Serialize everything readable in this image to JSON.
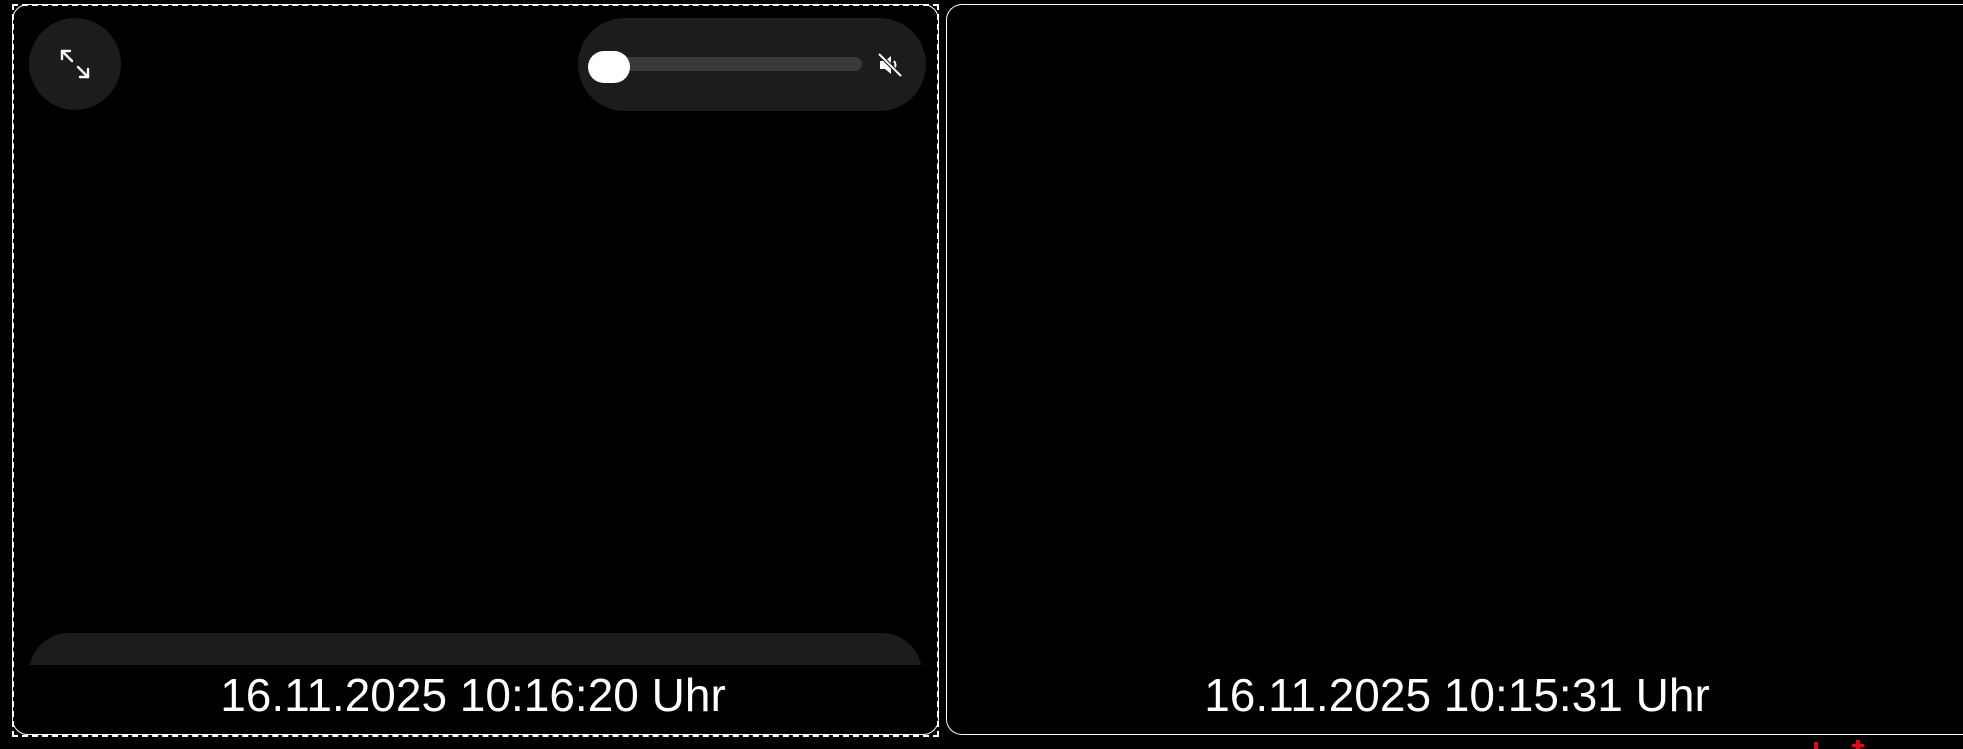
{
  "cameras": [
    {
      "timestamp": "16.11.2025 10:16:20 Uhr",
      "controls": {
        "fullscreen_icon": "expand-arrows-icon",
        "volume_level": 0,
        "mute_icon": "speaker-muted-icon"
      }
    },
    {
      "timestamp": "16.11.2025 10:15:31 Uhr"
    }
  ],
  "colors": {
    "background": "#000000",
    "panel": "#1c1c1c",
    "border": "#ffffff",
    "text": "#ffffff",
    "indicator": "#e30613"
  }
}
